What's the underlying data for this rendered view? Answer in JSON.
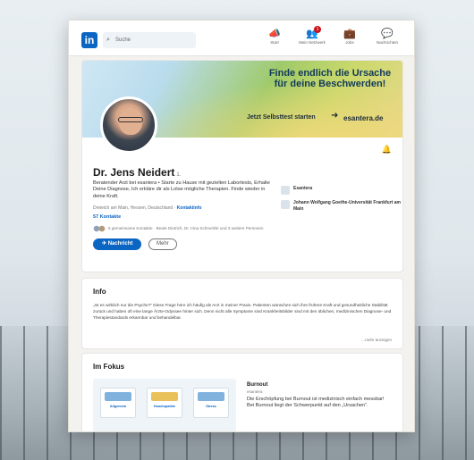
{
  "nav": {
    "logo": "in",
    "search_placeholder": "Suche",
    "items": [
      {
        "icon": "megaphone-icon",
        "glyph": "📣",
        "label": "Start",
        "badge": ""
      },
      {
        "icon": "people-icon",
        "glyph": "👥",
        "label": "Mein Netzwerk",
        "badge": "1"
      },
      {
        "icon": "briefcase-icon",
        "glyph": "💼",
        "label": "Jobs",
        "badge": ""
      },
      {
        "icon": "message-icon",
        "glyph": "💬",
        "label": "Nachrichten",
        "badge": ""
      }
    ]
  },
  "banner": {
    "headline": "Finde endlich die Ursache für deine Beschwerden!",
    "cta": "Jetzt Selbsttest starten",
    "brand": "esantera.de"
  },
  "profile": {
    "name": "Dr. Jens Neidert",
    "degree": "1.",
    "headline": "Beratender Arzt bei esantera • Starte zu Hause mit gezielten Labortests, Erhalte Deine Diagnose, Ich erkläre dir als Lotse mögliche Therapien. Finde wieder in deine Kraft.",
    "location": "Dreieich am Main, Hessen, Deutschland · ",
    "contact_info": "Kontaktinfo",
    "contacts": "57 Kontakte",
    "mutual": "5 gemeinsame Kontakte · Beate Dietrich, Dr. Irina Schmelzle und 3 weitere Personen",
    "message_button": "✈ Nachricht",
    "more_button": "Mehr",
    "orgs": [
      "Esantera",
      "Johann Wolfgang Goethe-Universität Frankfurt am Main"
    ]
  },
  "info": {
    "title": "Info",
    "text": "„Ist es wirklich nur die Psyche?“ Diese Frage höre ich häufig als Arzt in meiner Praxis. Patienten wünschen sich ihre frühere Kraft und gesundheitliche Stabilität zurück und haben oft eine lange Ärzte-Odyssee hinter sich. Denn nicht alle Symptome sind Krankheitsbilder sind mit den üblichen, medizinischen Diagnose- und Therapiestandards erkannbar und behandelbar.",
    "see_more": "…mehr anzeigen"
  },
  "fokus": {
    "title": "Im Fokus",
    "mini_labels": [
      "Allgemein",
      "Homöopathie",
      "Stress"
    ],
    "item_title": "Burnout",
    "item_source": "esantera",
    "item_text": "Die Erschöpfung bei Burnout ist medizinisch einfach messbar! Bei Burnout liegt der Schwerpunkt auf den „Ursachen“."
  }
}
